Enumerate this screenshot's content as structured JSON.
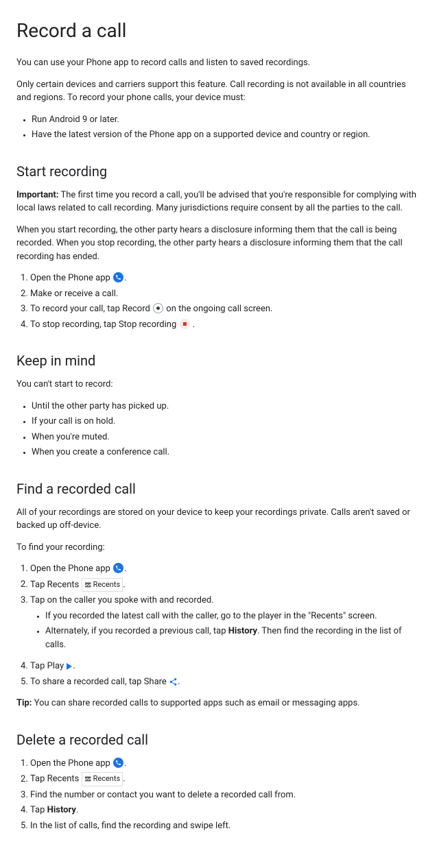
{
  "title": "Record a call",
  "intro1": "You can use your Phone app to record calls and listen to saved recordings.",
  "intro2": "Only certain devices and carriers support this feature. Call recording is not available in all countries and regions. To record your phone calls, your device must:",
  "reqs": [
    "Run Android 9 or later.",
    "Have the latest version of the Phone app on a supported device and country or region."
  ],
  "start": {
    "heading": "Start recording",
    "important_label": "Important:",
    "important_text": " The first time you record a call, you'll be advised that you're responsible for complying with local laws related to call recording. Many jurisdictions require consent by all the parties to the call.",
    "disclosure": "When you start recording, the other party hears a disclosure informing them that the call is being recorded. When you stop recording, the other party hears a disclosure informing them that the call recording has ended.",
    "steps": {
      "s1a": "Open the Phone app ",
      "s1b": ".",
      "s2": "Make or receive a call.",
      "s3a": "To record your call, tap Record ",
      "s3b": " on the ongoing call screen.",
      "s4a": "To stop recording, tap Stop recording ",
      "s4b": " ."
    }
  },
  "keep": {
    "heading": "Keep in mind",
    "intro": "You can't start to record:",
    "items": [
      "Until the other party has picked up.",
      "If your call is on hold.",
      "When you're muted.",
      "When you create a conference call."
    ]
  },
  "find": {
    "heading": "Find a recorded call",
    "intro": "All of your recordings are stored on your device to keep your recordings private. Calls aren't saved or backed up off-device.",
    "sub": "To find your recording:",
    "s1a": "Open the Phone app ",
    "s1b": ".",
    "s2a": "Tap Recents ",
    "s2alt": "Recents",
    "s2b": ".",
    "s3": "Tap on the caller you spoke with and recorded.",
    "s3sub1": "If you recorded the latest call with the caller, go to the player in the \"Recents\" screen.",
    "s3sub2a": "Alternately, if you recorded a previous call, tap ",
    "s3sub2bold": "History",
    "s3sub2b": ". Then find the recording in the list of calls.",
    "s4a": "Tap Play ",
    "s4b": ".",
    "s5a": "To share a recorded call, tap Share ",
    "s5b": ".",
    "tip_label": "Tip:",
    "tip_text": " You can share recorded calls to supported apps such as email or messaging apps."
  },
  "del": {
    "heading": "Delete a recorded call",
    "s1a": "Open the Phone app ",
    "s1b": ".",
    "s2a": "Tap Recents ",
    "s2alt": "Recents",
    "s2b": ".",
    "s3": "Find the number or contact you want to delete a recorded call from.",
    "s4a": "Tap ",
    "s4bold": "History",
    "s4b": ".",
    "s5": "In the list of calls, find the recording and swipe left."
  }
}
